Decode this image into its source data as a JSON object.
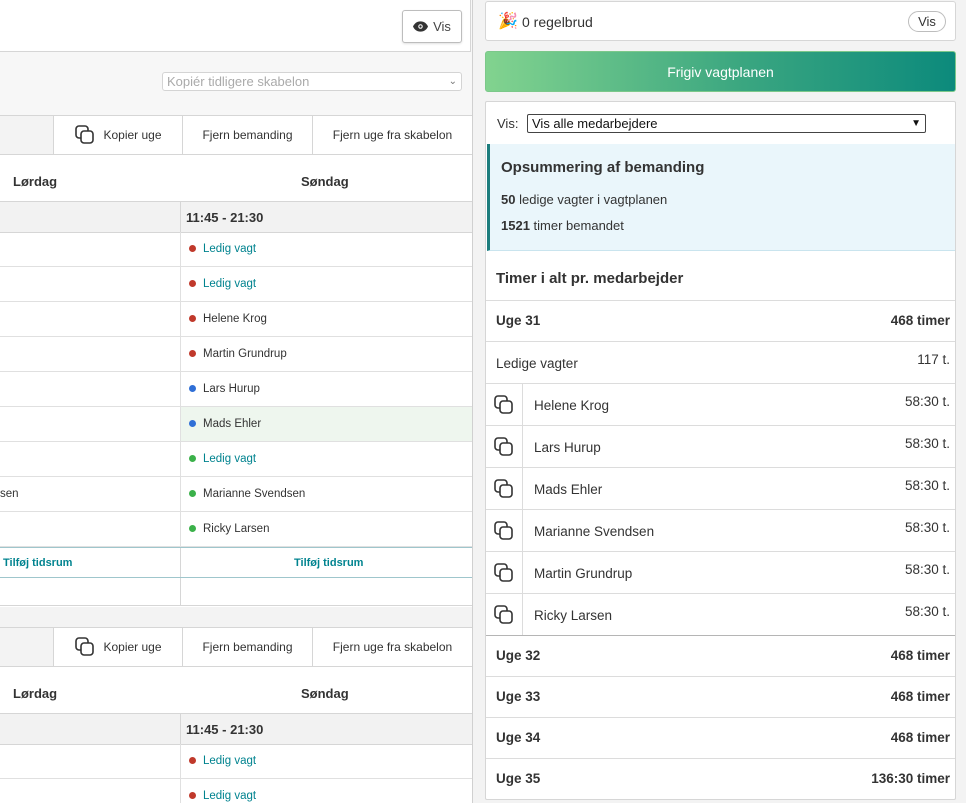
{
  "left": {
    "vis_button": "Vis",
    "template_select_placeholder": "Kopiér tidligere skabelon",
    "week_toolbar": {
      "copy_week": "Kopier uge",
      "remove_staffing": "Fjern bemanding",
      "remove_week": "Fjern uge fra skabelon"
    },
    "days": {
      "saturday": "Lørdag",
      "sunday": "Søndag"
    },
    "weeks": [
      {
        "time_range": "11:45 - 21:30",
        "shifts": [
          {
            "left": "",
            "right": "Ledig vagt",
            "dot": "#c0392b",
            "open": true
          },
          {
            "left": "",
            "right": "Ledig vagt",
            "dot": "#c0392b",
            "open": true
          },
          {
            "left": "",
            "right": "Helene Krog",
            "dot": "#c0392b",
            "open": false
          },
          {
            "left": "",
            "right": "Martin Grundrup",
            "dot": "#c0392b",
            "open": false
          },
          {
            "left": "",
            "right": "Lars Hurup",
            "dot": "#2f6fd6",
            "open": false
          },
          {
            "left": "",
            "right": "Mads Ehler",
            "dot": "#2f6fd6",
            "open": false
          },
          {
            "left": "",
            "right": "Ledig vagt",
            "dot": "#3bb14a",
            "open": true
          },
          {
            "left": "sen",
            "right": "Marianne Svendsen",
            "dot": "#3bb14a",
            "open": false
          },
          {
            "left": "",
            "right": "Ricky Larsen",
            "dot": "#3bb14a",
            "open": false
          }
        ],
        "add_left": "Tilføj tidsrum",
        "add_right": "Tilføj tidsrum"
      },
      {
        "time_range": "11:45 - 21:30",
        "shifts": [
          {
            "left": "",
            "right": "Ledig vagt",
            "dot": "#c0392b",
            "open": true
          },
          {
            "left": "",
            "right": "Ledig vagt",
            "dot": "#c0392b",
            "open": true
          }
        ]
      }
    ]
  },
  "right": {
    "rules": {
      "icon": "party-popper-icon",
      "label": "0 regelbrud",
      "button": "Vis"
    },
    "publish_button": "Frigiv vagtplanen",
    "filter": {
      "label": "Vis:",
      "selected": "Vis alle medarbejdere"
    },
    "summary": {
      "title": "Opsummering af bemanding",
      "open_count": "50",
      "open_text": "ledige vagter i vagtplanen",
      "hours_count": "1521",
      "hours_text": "timer bemandet"
    },
    "timer_title": "Timer i alt pr. medarbejder",
    "week31": {
      "label": "Uge 31",
      "hours": "468 timer"
    },
    "open_shifts": {
      "label": "Ledige vagter",
      "hours": "117 t."
    },
    "employees": [
      {
        "name": "Helene Krog",
        "hours": "58:30 t."
      },
      {
        "name": "Lars Hurup",
        "hours": "58:30 t."
      },
      {
        "name": "Mads Ehler",
        "hours": "58:30 t."
      },
      {
        "name": "Marianne Svendsen",
        "hours": "58:30 t."
      },
      {
        "name": "Martin Grundrup",
        "hours": "58:30 t."
      },
      {
        "name": "Ricky Larsen",
        "hours": "58:30 t."
      }
    ],
    "other_weeks": [
      {
        "label": "Uge 32",
        "hours": "468 timer"
      },
      {
        "label": "Uge 33",
        "hours": "468 timer"
      },
      {
        "label": "Uge 34",
        "hours": "468 timer"
      },
      {
        "label": "Uge 35",
        "hours": "136:30 timer"
      }
    ]
  }
}
